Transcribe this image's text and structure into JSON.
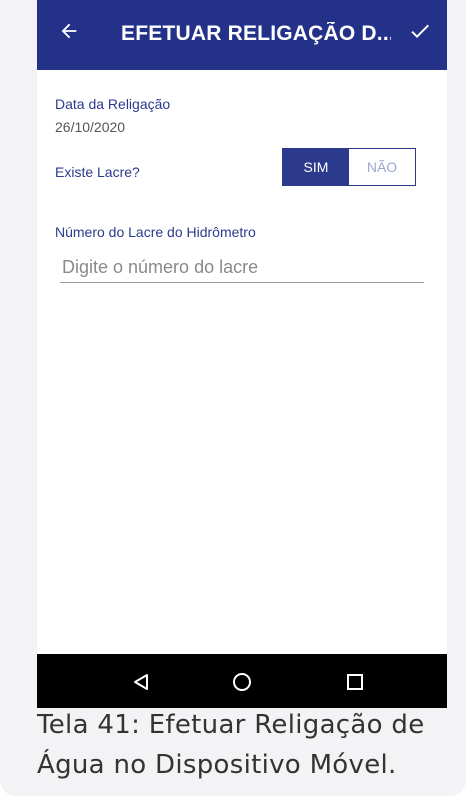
{
  "appbar": {
    "title": "EFETUAR RELIGAÇÃO D...",
    "back_icon": "arrow-left-icon",
    "confirm_icon": "check-icon"
  },
  "form": {
    "date_label": "Data da Religação",
    "date_value": "26/10/2020",
    "seal_question": "Existe Lacre?",
    "seal_yes": "SIM",
    "seal_no": "NÃO",
    "seal_selected": "SIM",
    "meter_seal_label": "Número do Lacre do Hidrômetro",
    "meter_seal_placeholder": "Digite o número do lacre",
    "meter_seal_value": ""
  },
  "navbar": {
    "back": "nav-back-icon",
    "home": "nav-home-icon",
    "recents": "nav-recents-icon"
  },
  "caption": {
    "line1": "Tela 41: Efetuar Religação de",
    "line2": "Água no Dispositivo Móvel."
  },
  "colors": {
    "primary": "#233288",
    "accent": "#2c3a8d",
    "toggle_inactive_text": "#9fa7d0",
    "navbar": "#000000"
  }
}
